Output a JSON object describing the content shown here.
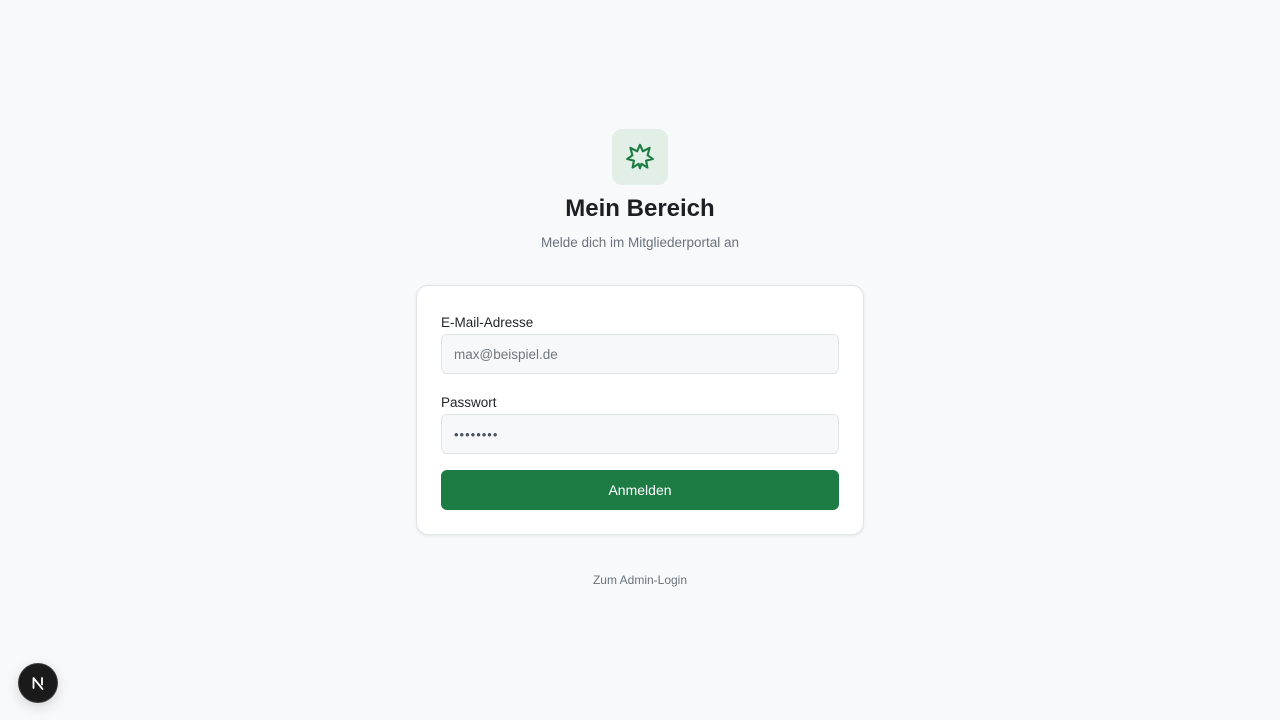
{
  "brand": {
    "logo_icon": "cannabis-leaf-icon",
    "logo_color": "#1c7c44",
    "logo_tile_color": "#e2efe6"
  },
  "header": {
    "title": "Mein Bereich",
    "subtitle": "Melde dich im Mitgliederportal an"
  },
  "form": {
    "email": {
      "label": "E-Mail-Adresse",
      "placeholder": "max@beispiel.de",
      "value": ""
    },
    "password": {
      "label": "Passwort",
      "value": "••••••••"
    },
    "submit_label": "Anmelden",
    "submit_color": "#1c7c44"
  },
  "footer": {
    "admin_link": "Zum Admin-Login"
  },
  "dev_badge": {
    "letter": "N",
    "icon": "nextjs-icon"
  }
}
